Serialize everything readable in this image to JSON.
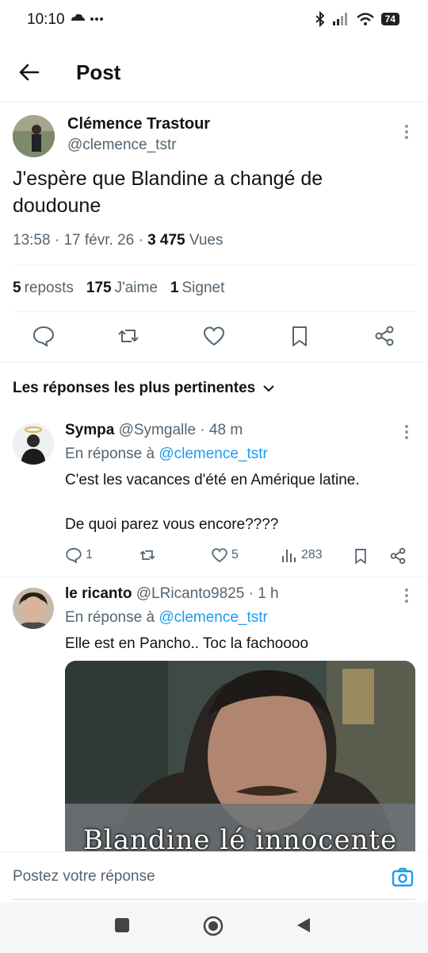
{
  "status_bar": {
    "time": "10:10",
    "battery": "74"
  },
  "header": {
    "title": "Post"
  },
  "post": {
    "author": "Clémence Trastour",
    "handle": "@clemence_tstr",
    "text": "J'espère que Blandine a changé de doudoune",
    "time": "13:58",
    "date": "17 févr. 26",
    "views_count": "3 475",
    "views_label": "Vues",
    "reposts_count": "5",
    "reposts_label": "reposts",
    "likes_count": "175",
    "likes_label": "J'aime",
    "bookmarks_count": "1",
    "bookmarks_label": "Signet"
  },
  "replies_section": {
    "title": "Les réponses les plus pertinentes"
  },
  "replies": [
    {
      "name": "Sympa",
      "handle": "@Symgalle",
      "time": "48 m",
      "reply_prefix": "En réponse à",
      "reply_to": "@clemence_tstr",
      "text": "C'est les vacances d'été en Amérique latine.\n\nDe quoi parez vous encore????",
      "comments": "1",
      "likes": "5",
      "views": "283"
    },
    {
      "name": "le ricanto",
      "handle": "@LRicanto9825",
      "time": "1 h",
      "reply_prefix": "En réponse à",
      "reply_to": "@clemence_tstr",
      "text": "Elle est en Pancho.. Toc la fachoooo",
      "media_caption": "Blandine lé innocente"
    }
  ],
  "compose": {
    "placeholder": "Postez votre réponse"
  }
}
